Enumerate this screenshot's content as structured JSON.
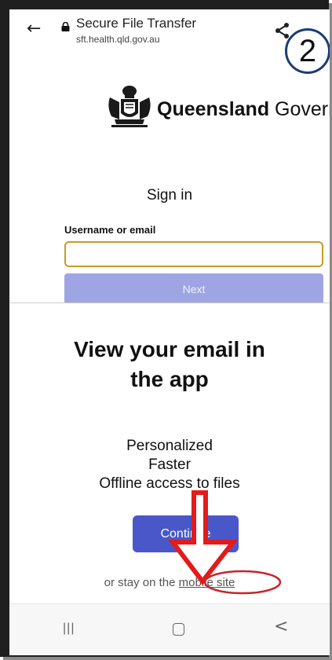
{
  "browser": {
    "title": "Secure File Transfer",
    "url": "sft.health.qld.gov.au"
  },
  "step_badge": "2",
  "page": {
    "org_name_bold": "Queensland",
    "org_name_rest": " Govern",
    "heading": "Sign in",
    "username_label": "Username or email",
    "username_value": "",
    "next_label": "Next"
  },
  "sheet": {
    "title_line1": "View your email in",
    "title_line2": "the app",
    "features": [
      "Personalized",
      "Faster",
      "Offline access to files"
    ],
    "continue_label": "Continue",
    "stay_prefix": "or stay on the ",
    "mobile_link": "mobile site"
  },
  "nav": {
    "recent": "|||",
    "back": "<"
  },
  "colors": {
    "badge_border": "#1d3c73",
    "input_border": "#c99a28",
    "next_button": "#9ea5e2",
    "continue_button": "#4a57c8",
    "annotation_red": "#e31b1b"
  }
}
